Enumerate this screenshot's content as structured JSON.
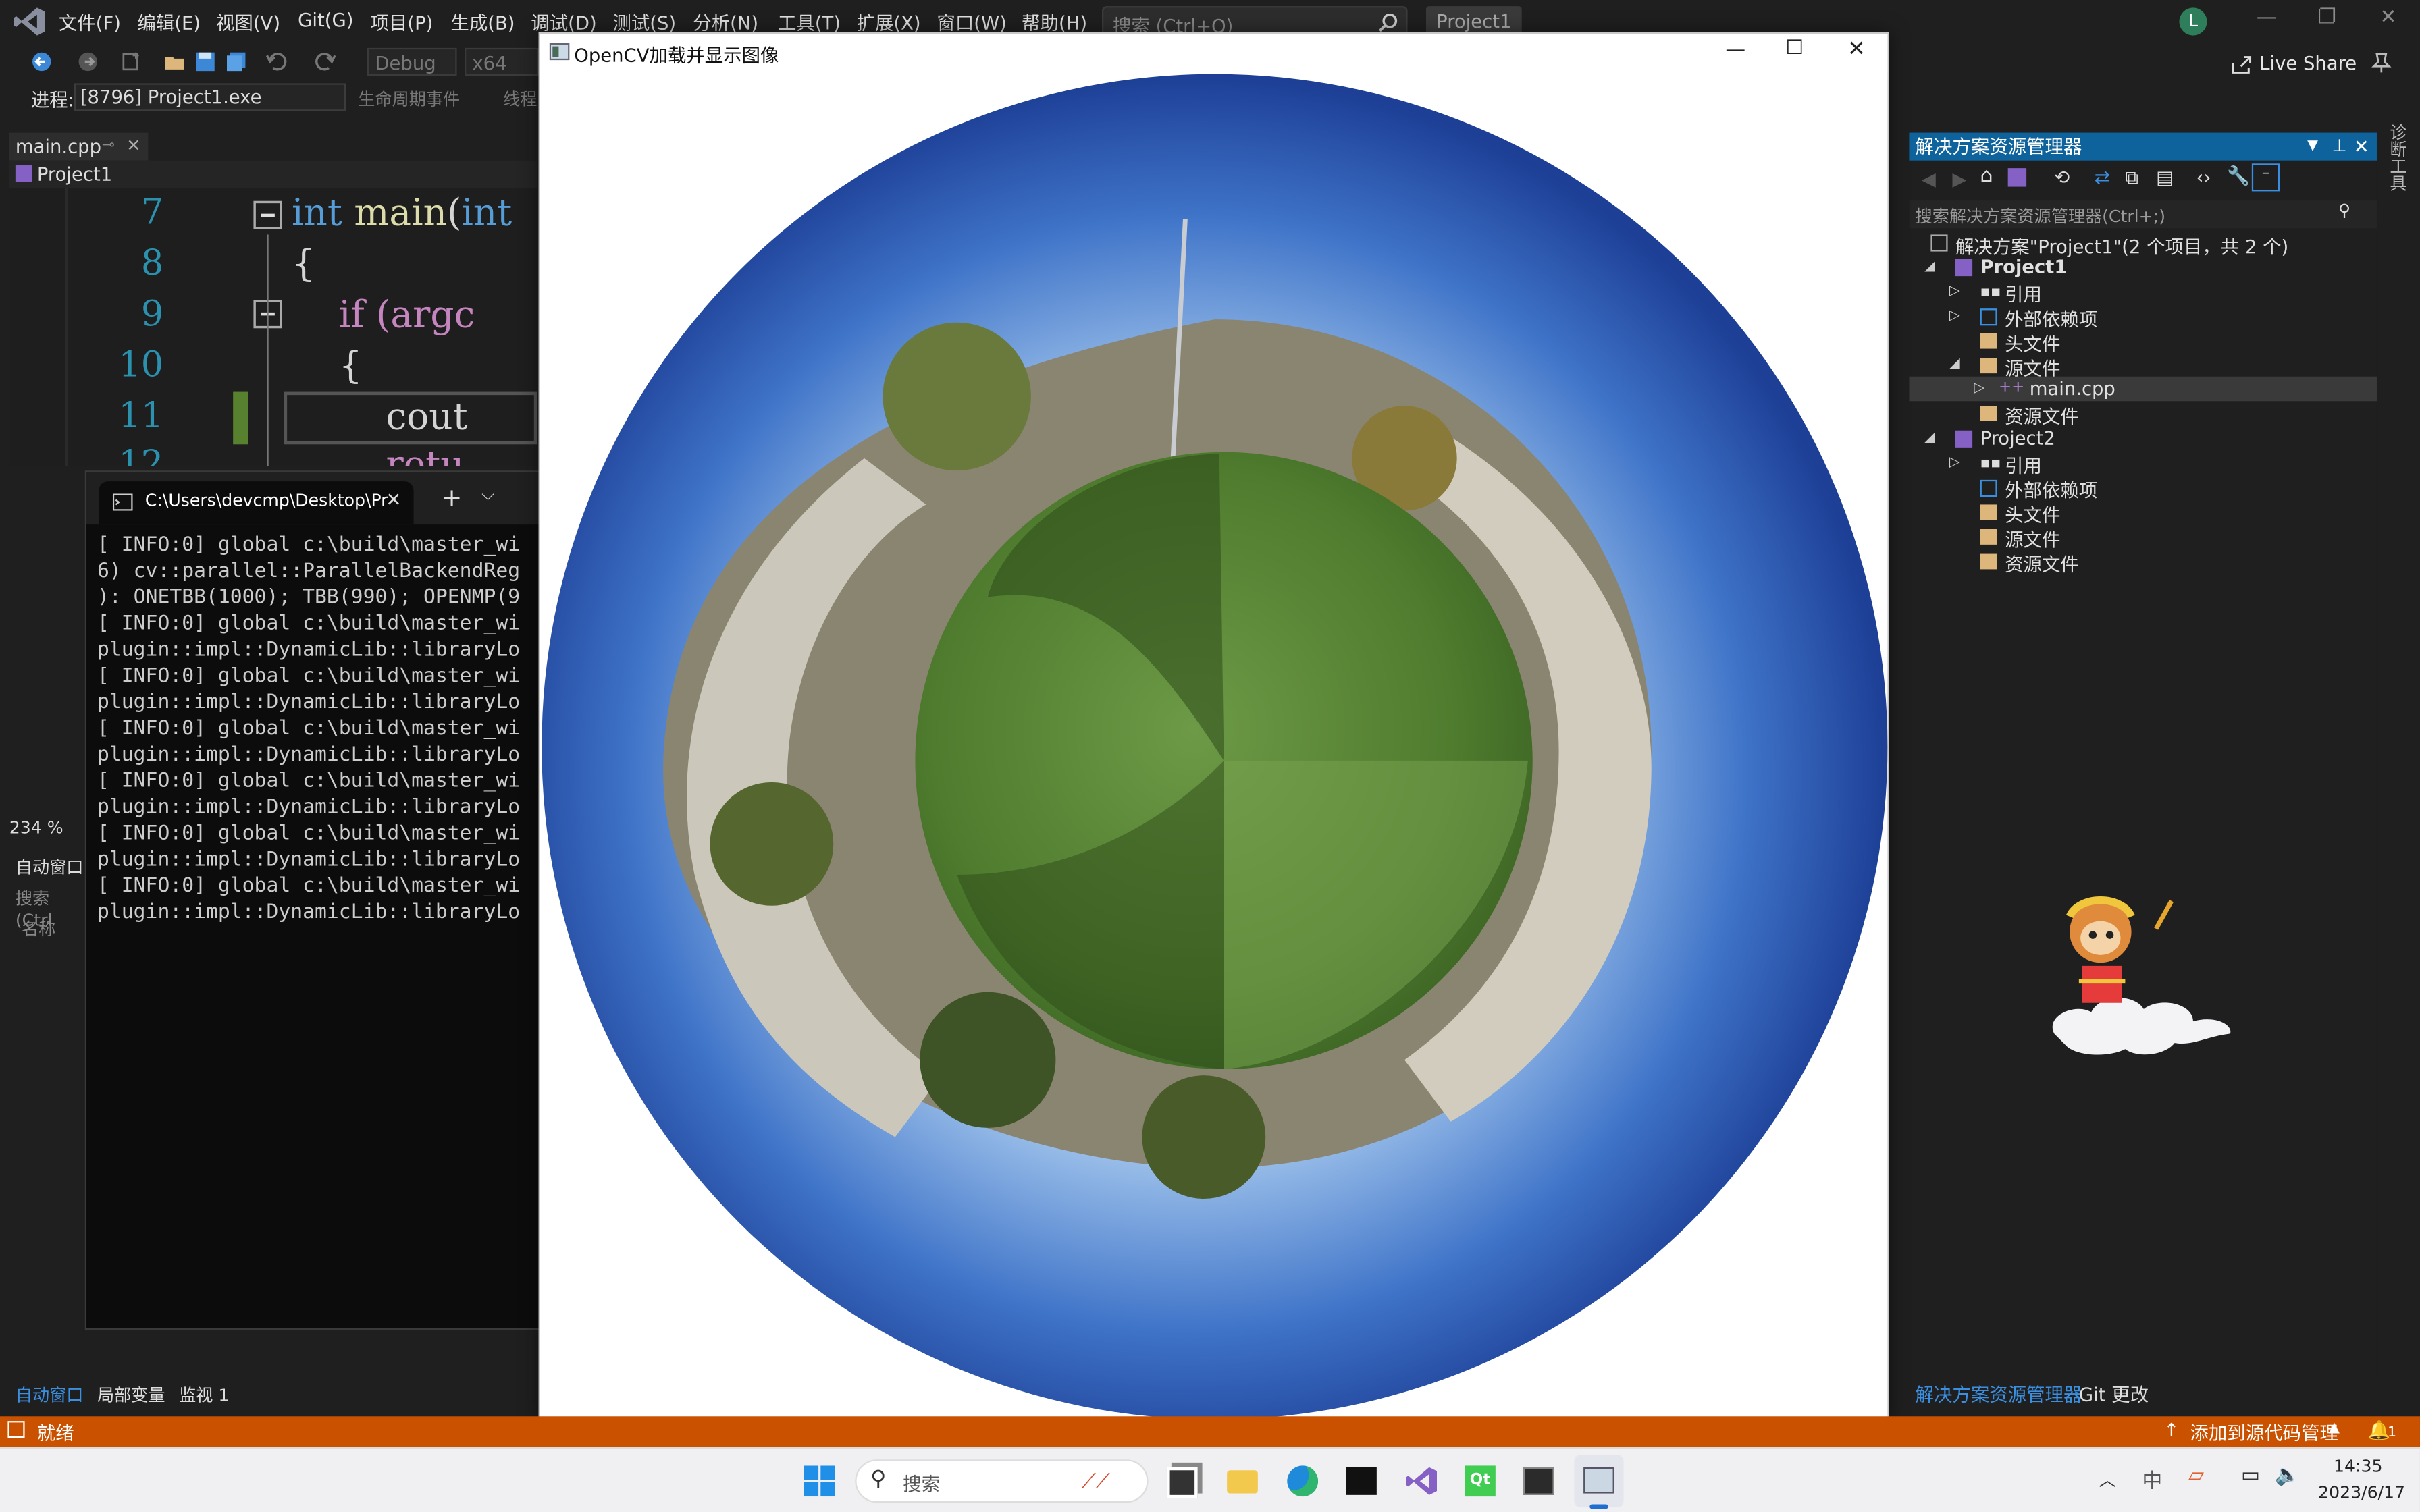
{
  "menu": [
    "文件(F)",
    "编辑(E)",
    "视图(V)",
    "Git(G)",
    "项目(P)",
    "生成(B)",
    "调试(D)",
    "测试(S)",
    "分析(N)",
    "工具(T)",
    "扩展(X)",
    "窗口(W)",
    "帮助(H)"
  ],
  "search": {
    "placeholder": "搜索 (Ctrl+Q)"
  },
  "project_title": "Project1",
  "user_initial": "L",
  "toolbar": {
    "config": "Debug",
    "platform": "x64",
    "live_share": "Live Share"
  },
  "process": {
    "label": "进程:",
    "value": "[8796] Project1.exe",
    "lifecycle": "生命周期事件",
    "thread": "线程"
  },
  "editor": {
    "tab": "main.cpp",
    "nav": "Project1",
    "lines": [
      {
        "n": "7",
        "code": "int main(int"
      },
      {
        "n": "8",
        "code": "{"
      },
      {
        "n": "9",
        "code": "    if (argc"
      },
      {
        "n": "10",
        "code": "    {"
      },
      {
        "n": "11",
        "code": "        cout"
      },
      {
        "n": "12",
        "code": "        retu"
      }
    ]
  },
  "terminal": {
    "tab_title": "C:\\Users\\devcmp\\Desktop\\Pr",
    "lines": [
      "[ INFO:0] global c:\\build\\master_wi",
      "6) cv::parallel::ParallelBackendReg",
      "): ONETBB(1000); TBB(990); OPENMP(9",
      "[ INFO:0] global c:\\build\\master_wi",
      "plugin::impl::DynamicLib::libraryLo",
      "[ INFO:0] global c:\\build\\master_wi",
      "plugin::impl::DynamicLib::libraryLo",
      "[ INFO:0] global c:\\build\\master_wi",
      "plugin::impl::DynamicLib::libraryLo",
      "[ INFO:0] global c:\\build\\master_wi",
      "plugin::impl::DynamicLib::libraryLo",
      "[ INFO:0] global c:\\build\\master_wi",
      "plugin::impl::DynamicLib::libraryLo",
      "[ INFO:0] global c:\\build\\master_wi",
      "plugin::impl::DynamicLib::libraryLo"
    ]
  },
  "zoom": "234 %",
  "auto_window": {
    "title": "自动窗口",
    "search": "搜索(Ctrl",
    "col_name": "名称"
  },
  "bottom_tabs": [
    "自动窗口",
    "局部变量",
    "监视 1"
  ],
  "opencv_window": {
    "title": "OpenCV加载并显示图像"
  },
  "solution_explorer": {
    "title": "解决方案资源管理器",
    "search": "搜索解决方案资源管理器(Ctrl+;)",
    "root": "解决方案\"Project1\"(2 个项目，共 2 个)",
    "project1": {
      "name": "Project1",
      "items": [
        "引用",
        "外部依赖项",
        "头文件",
        "源文件",
        "main.cpp",
        "资源文件"
      ]
    },
    "project2": {
      "name": "Project2",
      "items": [
        "引用",
        "外部依赖项",
        "头文件",
        "源文件",
        "资源文件"
      ]
    }
  },
  "right_tabs": [
    "解决方案资源管理器",
    "Git 更改"
  ],
  "diag_tools": "诊断工具",
  "status": {
    "ready": "就绪",
    "source_control": "添加到源代码管理",
    "notif": "1"
  },
  "taskbar": {
    "search": "搜索",
    "time": "14:35",
    "date": "2023/6/17"
  },
  "colors": {
    "accent": "#0e639c",
    "status": "#ca5100",
    "vs_purple": "#8661c5"
  }
}
